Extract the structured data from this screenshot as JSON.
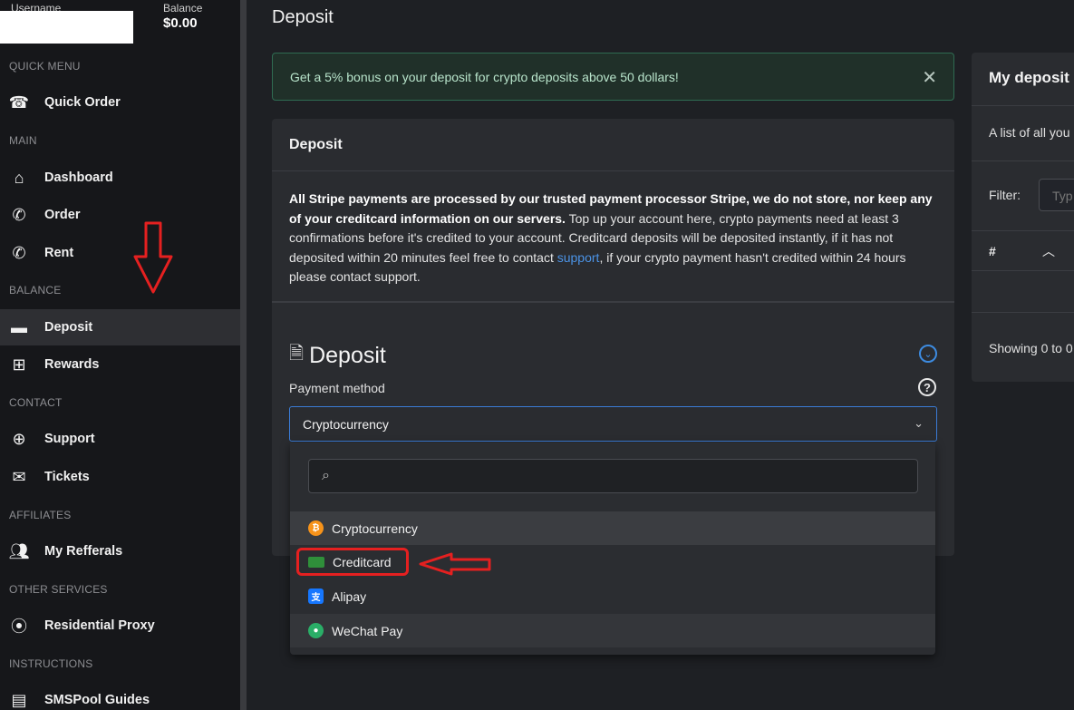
{
  "user": {
    "username_label": "Username",
    "balance_label": "Balance",
    "balance_value": "$0.00"
  },
  "sidebar": {
    "sections": {
      "quick_menu": "QUICK MENU",
      "main": "MAIN",
      "balance": "BALANCE",
      "contact": "CONTACT",
      "affiliates": "AFFILIATES",
      "other_services": "OTHER SERVICES",
      "instructions": "INSTRUCTIONS"
    },
    "items": {
      "quick_order": "Quick Order",
      "dashboard": "Dashboard",
      "order": "Order",
      "rent": "Rent",
      "deposit": "Deposit",
      "rewards": "Rewards",
      "support": "Support",
      "tickets": "Tickets",
      "my_referrals": "My Refferals",
      "residential_proxy": "Residential Proxy",
      "guides": "SMSPool Guides"
    },
    "active_item": "Deposit"
  },
  "page": {
    "title": "Deposit",
    "alert": "Get a 5% bonus on your deposit for crypto deposits above 50 dollars!",
    "card_title": "Deposit",
    "info": {
      "bold": "All Stripe payments are processed by our trusted payment processor Stripe, we do not store, nor keep any of your creditcard information on our servers.",
      "text_a": " Top up your account here, crypto payments need at least 3 confirmations before it's credited to your account. Creditcard deposits will be deposited instantly, if it has not deposited within 20 minutes feel free to contact ",
      "link": "support",
      "text_b": ", if your crypto payment hasn't credited within 24 hours please contact support."
    },
    "deposit_heading": "Deposit",
    "payment_method_label": "Payment method",
    "selected_method": "Cryptocurrency",
    "dropdown_options": [
      {
        "label": "Cryptocurrency",
        "icon": "bitcoin-icon",
        "color": "#f7931a"
      },
      {
        "label": "Creditcard",
        "icon": "credit-card-icon",
        "color": "#2f8f3a"
      },
      {
        "label": "Alipay",
        "icon": "alipay-icon",
        "color": "#1677ff"
      },
      {
        "label": "WeChat Pay",
        "icon": "wechat-icon",
        "color": "#2aae67"
      }
    ]
  },
  "right_card": {
    "title": "My deposit",
    "description": "A list of all you",
    "filter_label": "Filter:",
    "filter_placeholder": "Typ",
    "column_hash": "#",
    "showing": "Showing 0 to 0"
  },
  "colors": {
    "accent": "#3a7bd5",
    "alert_bg": "#203029",
    "annotation_red": "#e52020"
  }
}
